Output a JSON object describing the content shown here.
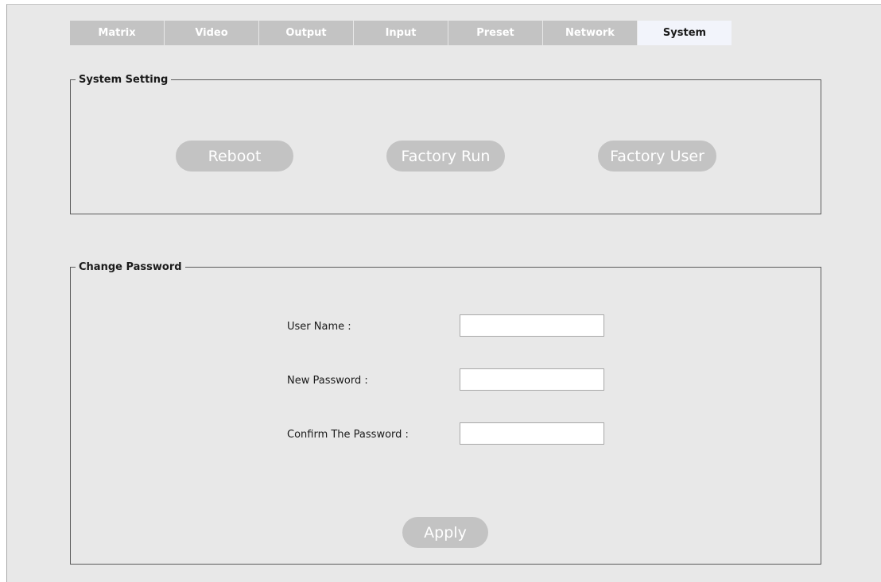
{
  "tabs": [
    {
      "label": "Matrix",
      "active": false
    },
    {
      "label": "Video",
      "active": false
    },
    {
      "label": "Output",
      "active": false
    },
    {
      "label": "Input",
      "active": false
    },
    {
      "label": "Preset",
      "active": false
    },
    {
      "label": "Network",
      "active": false
    },
    {
      "label": "System",
      "active": true
    }
  ],
  "system_setting": {
    "title": "System Setting",
    "buttons": {
      "reboot": "Reboot",
      "factory_run": "Factory Run",
      "factory_user": "Factory User"
    }
  },
  "change_password": {
    "title": "Change Password",
    "fields": {
      "user_name": {
        "label": "User Name :",
        "value": ""
      },
      "new_password": {
        "label": "New Password :",
        "value": ""
      },
      "confirm_password": {
        "label": "Confirm The Password :",
        "value": ""
      }
    },
    "apply_label": "Apply"
  },
  "colors": {
    "page_background": "#e8e8e8",
    "tab_inactive": "#c3c3c3",
    "tab_active": "#f2f4fb",
    "button_fill": "#c3c3c3",
    "button_text": "#ffffff"
  }
}
